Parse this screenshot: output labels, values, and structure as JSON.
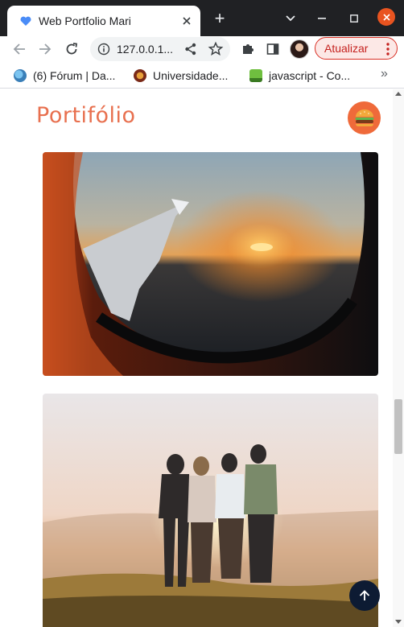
{
  "browser": {
    "tab": {
      "title": "Web Portfolio Mari",
      "favicon": "blue-heart-icon"
    },
    "new_tab_symbol": "+",
    "omnibox": {
      "url": "127.0.0.1..."
    },
    "update_button": {
      "label": "Atualizar"
    },
    "bookmarks": [
      {
        "label": "(6) Fórum | Da...",
        "icon": "globe-icon"
      },
      {
        "label": "Universidade...",
        "icon": "university-icon"
      },
      {
        "label": "javascript - Co...",
        "icon": "stackoverflow-icon"
      }
    ],
    "bookmarks_more": "»"
  },
  "page": {
    "title": "Portifólio",
    "menu_icon": "burger-icon",
    "photos": [
      {
        "subject": "airplane-window-sunset"
      },
      {
        "subject": "friends-embracing-at-sunset"
      }
    ],
    "back_to_top_icon": "arrow-up-icon"
  },
  "colors": {
    "title": "#e8704f",
    "menu_button_bg": "#ef6a3a",
    "back_to_top_bg": "#0d1b33",
    "update_text": "#c5221f",
    "tabstrip_bg": "#202124"
  }
}
